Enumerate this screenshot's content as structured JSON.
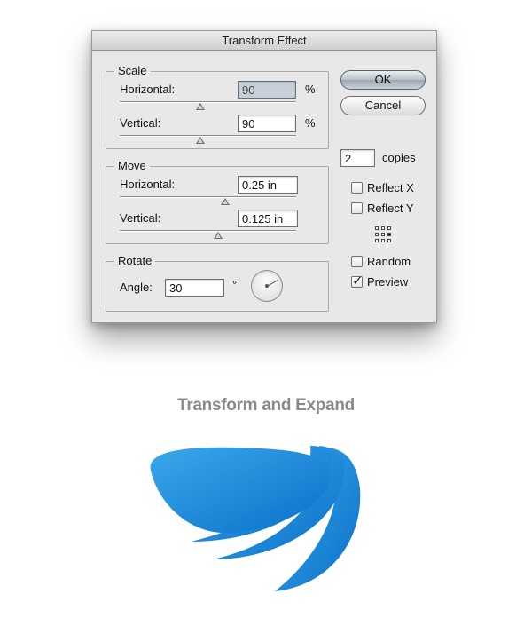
{
  "dialog": {
    "title": "Transform Effect",
    "scale": {
      "title": "Scale",
      "horizontal_label": "Horizontal:",
      "horizontal_value": "90",
      "horizontal_unit": "%",
      "vertical_label": "Vertical:",
      "vertical_value": "90",
      "vertical_unit": "%"
    },
    "move": {
      "title": "Move",
      "horizontal_label": "Horizontal:",
      "horizontal_value": "0.25 in",
      "vertical_label": "Vertical:",
      "vertical_value": "0.125 in"
    },
    "rotate": {
      "title": "Rotate",
      "angle_label": "Angle:",
      "angle_value": "30",
      "angle_unit": "°"
    },
    "buttons": {
      "ok": "OK",
      "cancel": "Cancel"
    },
    "copies": {
      "value": "2",
      "label": "copies"
    },
    "options": {
      "reflect_x": {
        "label": "Reflect X",
        "checked": false
      },
      "reflect_y": {
        "label": "Reflect Y",
        "checked": false
      },
      "random": {
        "label": "Random",
        "checked": false
      },
      "preview": {
        "label": "Preview",
        "checked": true
      }
    }
  },
  "caption": "Transform and Expand",
  "colors": {
    "shape_light": "#2e9fe8",
    "shape_dark": "#0a73cc",
    "dialog_bg": "#e8e8e8"
  }
}
